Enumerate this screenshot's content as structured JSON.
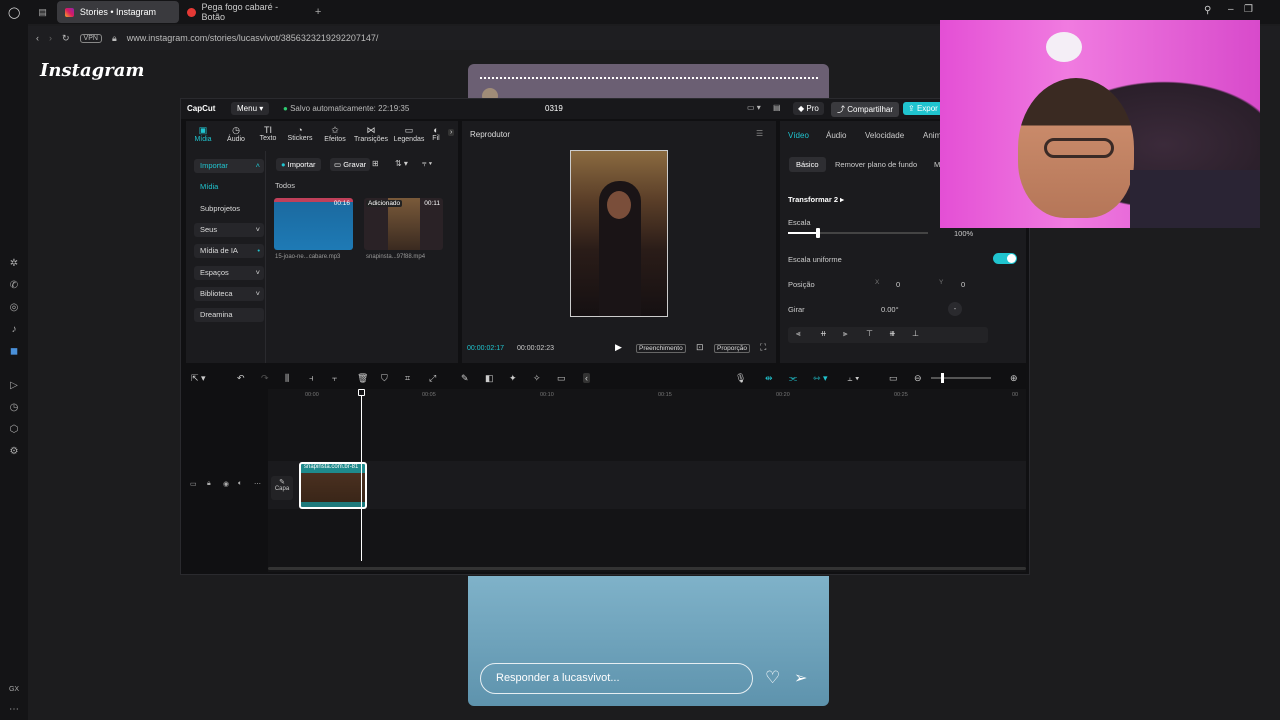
{
  "browser": {
    "tabs": [
      {
        "label": "Stories • Instagram",
        "active": true
      },
      {
        "label": "Pega fogo cabaré - Botão",
        "active": false
      }
    ],
    "vpn": "VPN",
    "url": "www.instagram.com/stories/lucasvivot/3856323219292207147/"
  },
  "instagram": {
    "logo": "Instagram",
    "reply_placeholder": "Responder a lucasvivot..."
  },
  "capcut": {
    "brand": "CapCut",
    "menu": "Menu",
    "autosave": "Salvo automaticamente: 22:19:35",
    "project_name": "0319",
    "pro": "Pro",
    "share": "Compartilhar",
    "export": "Expor",
    "toolbar": [
      "Mídia",
      "Áudio",
      "Texto",
      "Stickers",
      "Efeitos",
      "Transições",
      "Legendas",
      "Fil"
    ],
    "sidebar": [
      "Importar",
      "Mídia",
      "Subprojetos",
      "Seus",
      "Mídia de IA",
      "Espaços",
      "Biblioteca",
      "Dreamina"
    ],
    "media_actions": {
      "import": "Importar",
      "record": "Gravar"
    },
    "media_section": "Todos",
    "media_items": [
      {
        "name": "15-joao-ne...cabare.mp3",
        "duration": "00:16",
        "badge": ""
      },
      {
        "name": "snapinsta...97f88.mp4",
        "duration": "00:11",
        "badge": "Adicionado"
      }
    ],
    "player": {
      "title": "Reprodutor",
      "current_time": "00:00:02:17",
      "total_time": "00:00:02:23",
      "fill_label": "Preenchimento",
      "ratio_label": "Proporção"
    },
    "right_panel": {
      "tabs": [
        "Vídeo",
        "Áudio",
        "Velocidade",
        "Anim"
      ],
      "subtabs": [
        "Básico",
        "Remover plano de fundo",
        "M"
      ],
      "section": "Transformar 2",
      "scale_label": "Escala",
      "scale_value": "100%",
      "uniform_label": "Escala uniforme",
      "position_label": "Posição",
      "pos_x_label": "X",
      "pos_x": "0",
      "pos_y_label": "Y",
      "pos_y": "0",
      "rotate_label": "Girar",
      "rotate_value": "0.00°",
      "rotate_dash": "-"
    },
    "timeline": {
      "ruler": [
        "00:00",
        "00:05",
        "00:10",
        "00:15",
        "00:20",
        "00:25",
        "00"
      ],
      "cover_label": "Capa",
      "clip_name": "snapinsta.com.br-81"
    }
  }
}
